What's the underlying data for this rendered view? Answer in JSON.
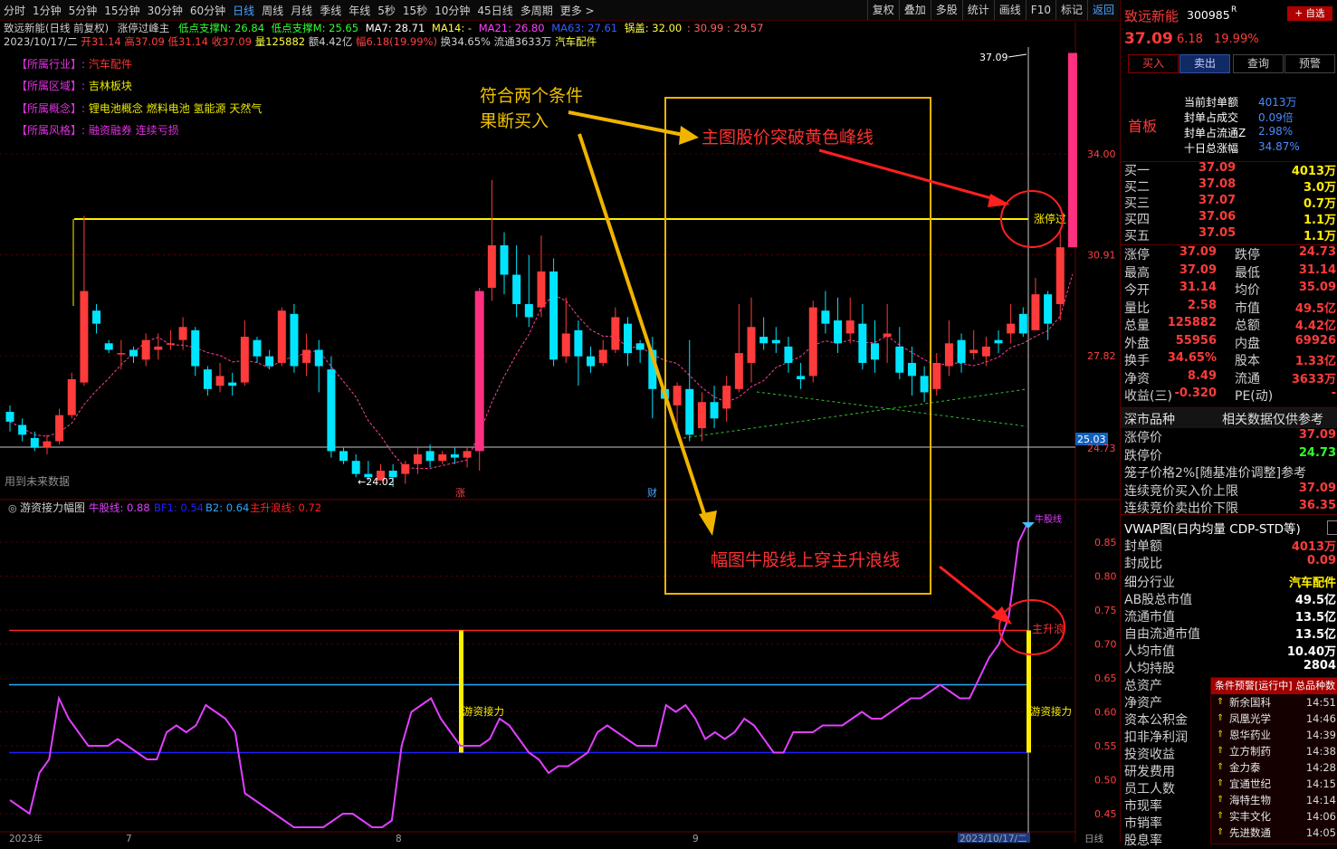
{
  "toolbar": {
    "periods": [
      "分时",
      "1分钟",
      "5分钟",
      "15分钟",
      "30分钟",
      "60分钟",
      "日线",
      "周线",
      "月线",
      "季线",
      "年线",
      "5秒",
      "15秒",
      "10分钟",
      "45日线",
      "多周期",
      "更多 >"
    ],
    "active_period": "日线",
    "tools": [
      "复权",
      "叠加",
      "多股",
      "统计",
      "画线",
      "F10",
      "标记",
      "返回"
    ]
  },
  "stock": {
    "title_line": "致远新能(日线 前复权)",
    "indicator_name": "涨停过峰主",
    "support_n": "低点支撑N: 26.84",
    "support_m": "低点支撑M: 25.65",
    "ma7": "MA7: 28.71",
    "ma14": "MA14: -",
    "ma21": "MA21: 26.80",
    "ma63": "MA63: 27.61",
    "pot_lid": "锅盖: 32.00",
    "levels": ": 30.99 : 29.57",
    "date": "2023/10/17/二",
    "open": "开31.14",
    "high": "高37.09",
    "low": "低31.14",
    "close": "收37.09",
    "volume": "量125882",
    "amount": "额4.42亿",
    "change": "幅6.18(19.99%)",
    "turnover": "换34.65%",
    "float": "流通3633万",
    "sector": "汽车配件"
  },
  "tags": [
    {
      "k": "【所属行业】:",
      "v": "汽车配件",
      "color": "#ff3030"
    },
    {
      "k": "【所属区域】:",
      "v": "吉林板块",
      "color": "#e8e800"
    },
    {
      "k": "【所属概念】:",
      "v": "锂电池概念 燃料电池 氢能源 天然气",
      "color": "#e8e800"
    },
    {
      "k": "【所属风格】:",
      "v": "融资融券 连续亏损",
      "color": "#e030e0"
    }
  ],
  "main_chart": {
    "y_ticks": [
      "34.00",
      "30.91",
      "27.82",
      "25.03",
      "24.73"
    ],
    "peak_label": "37.09",
    "low_label": "←24.02",
    "zt_label": "涨停过",
    "current_price_box": "25.03",
    "marker_zhang": "涨",
    "marker_cai": "财",
    "future_note": "用到未来数据"
  },
  "candles": [
    [
      26.1,
      25.8,
      26.3,
      25.5
    ],
    [
      25.7,
      25.4,
      25.9,
      25.2
    ],
    [
      25.3,
      25.0,
      25.5,
      24.9
    ],
    [
      25.0,
      25.2,
      25.4,
      24.8
    ],
    [
      25.2,
      26.0,
      26.2,
      25.1
    ],
    [
      26.0,
      27.1,
      27.3,
      25.9
    ],
    [
      27.0,
      29.8,
      32.1,
      26.9
    ],
    [
      29.2,
      28.8,
      29.4,
      28.5
    ],
    [
      28.2,
      28.0,
      28.3,
      27.9
    ],
    [
      27.9,
      27.9,
      28.3,
      27.4
    ],
    [
      28.0,
      27.8,
      28.1,
      27.6
    ],
    [
      27.7,
      28.3,
      28.5,
      27.5
    ],
    [
      28.0,
      28.1,
      28.5,
      27.7
    ],
    [
      28.2,
      28.2,
      28.6,
      28.0
    ],
    [
      28.3,
      28.7,
      29.0,
      28.0
    ],
    [
      28.6,
      27.5,
      28.7,
      27.2
    ],
    [
      27.4,
      26.8,
      27.5,
      26.6
    ],
    [
      26.9,
      27.2,
      27.6,
      26.7
    ],
    [
      27.0,
      26.9,
      27.3,
      26.6
    ],
    [
      27.0,
      28.4,
      28.9,
      26.9
    ],
    [
      28.3,
      27.8,
      28.4,
      27.6
    ],
    [
      27.8,
      27.5,
      28.0,
      27.4
    ],
    [
      27.6,
      29.2,
      29.3,
      27.5
    ],
    [
      29.1,
      27.5,
      29.4,
      27.3
    ],
    [
      27.6,
      28.0,
      28.5,
      27.2
    ],
    [
      28.0,
      27.5,
      28.3,
      26.7
    ],
    [
      27.4,
      24.9,
      27.8,
      24.7
    ],
    [
      24.9,
      24.6,
      25.0,
      24.5
    ],
    [
      24.6,
      24.2,
      24.8,
      24.1
    ],
    [
      24.2,
      24.1,
      24.6,
      24.0
    ],
    [
      24.0,
      24.3,
      24.5,
      24.0
    ],
    [
      24.3,
      24.1,
      24.5,
      23.8
    ],
    [
      24.2,
      24.5,
      24.6,
      23.9
    ],
    [
      24.5,
      24.8,
      25.0,
      24.2
    ],
    [
      24.9,
      24.6,
      25.1,
      24.4
    ],
    [
      24.6,
      24.8,
      24.9,
      24.5
    ],
    [
      24.8,
      24.7,
      25.0,
      24.5
    ],
    [
      24.7,
      24.9,
      25.0,
      24.4
    ],
    [
      24.9,
      29.8,
      29.9,
      24.3
    ],
    [
      29.9,
      31.2,
      33.2,
      29.5
    ],
    [
      31.2,
      30.3,
      31.6,
      29.7
    ],
    [
      30.3,
      29.4,
      31.2,
      29.0
    ],
    [
      29.4,
      29.0,
      30.9,
      28.7
    ],
    [
      29.3,
      30.4,
      31.5,
      29.0
    ],
    [
      30.4,
      27.7,
      30.8,
      27.5
    ],
    [
      27.8,
      28.5,
      29.6,
      27.6
    ],
    [
      28.6,
      27.8,
      28.9,
      26.9
    ],
    [
      27.8,
      27.5,
      28.1,
      27.3
    ],
    [
      27.6,
      28.0,
      28.3,
      27.5
    ],
    [
      28.0,
      29.0,
      29.3,
      27.9
    ],
    [
      28.8,
      27.9,
      29.0,
      27.5
    ],
    [
      28.2,
      28.0,
      28.3,
      27.6
    ],
    [
      28.0,
      26.8,
      28.4,
      25.9
    ],
    [
      26.8,
      26.5,
      27.1,
      26.2
    ],
    [
      26.3,
      26.9,
      27.0,
      25.6
    ],
    [
      26.8,
      25.4,
      28.3,
      25.2
    ],
    [
      25.6,
      26.4,
      26.7,
      25.2
    ],
    [
      26.4,
      25.9,
      26.9,
      25.6
    ],
    [
      26.2,
      26.9,
      27.2,
      25.8
    ],
    [
      26.8,
      27.9,
      29.4,
      26.7
    ],
    [
      27.6,
      28.7,
      29.6,
      27.0
    ],
    [
      28.4,
      28.2,
      29.0,
      28.0
    ],
    [
      28.3,
      28.2,
      28.7,
      27.9
    ],
    [
      28.1,
      27.6,
      28.4,
      27.3
    ],
    [
      27.2,
      27.1,
      27.6,
      26.8
    ],
    [
      27.2,
      29.3,
      29.5,
      27.0
    ],
    [
      29.2,
      28.8,
      29.8,
      28.5
    ],
    [
      28.9,
      28.2,
      29.6,
      27.9
    ],
    [
      28.5,
      28.9,
      29.6,
      28.2
    ],
    [
      28.8,
      27.6,
      29.4,
      27.4
    ],
    [
      28.2,
      27.7,
      28.9,
      27.3
    ],
    [
      28.4,
      28.5,
      29.4,
      27.6
    ],
    [
      28.1,
      27.3,
      28.7,
      27.1
    ],
    [
      27.6,
      27.2,
      28.1,
      26.6
    ],
    [
      27.2,
      26.7,
      27.5,
      26.4
    ],
    [
      26.8,
      27.6,
      27.9,
      26.6
    ],
    [
      27.5,
      28.2,
      28.9,
      27.2
    ],
    [
      28.3,
      27.6,
      28.5,
      27.3
    ],
    [
      27.9,
      28.0,
      28.6,
      27.7
    ],
    [
      27.8,
      28.1,
      28.4,
      27.5
    ],
    [
      28.3,
      28.2,
      28.6,
      27.9
    ],
    [
      28.5,
      28.8,
      29.4,
      28.2
    ],
    [
      29.1,
      28.5,
      29.3,
      28.4
    ],
    [
      28.6,
      29.7,
      30.2,
      28.6
    ],
    [
      29.7,
      28.8,
      29.8,
      28.3
    ],
    [
      29.4,
      31.14,
      31.6,
      28.9
    ],
    [
      31.14,
      37.09,
      37.09,
      31.14
    ]
  ],
  "osc_panel": {
    "title": "游资接力幅图",
    "niu_label": "牛股线: 0.88",
    "bf1": "BF1: 0.54",
    "b2": "B2: 0.64",
    "zsl": "主升浪线: 0.72",
    "y_ticks": [
      "0.85",
      "0.80",
      "0.75",
      "0.70",
      "0.65",
      "0.60",
      "0.55",
      "0.50",
      "0.45"
    ],
    "label_relay": "游资接力",
    "label_zsl": "主升浪",
    "label_niu": "牛股线",
    "x_labels": [
      "2023年",
      "7",
      "8",
      "9",
      "2023/10/17/二",
      "日线"
    ]
  },
  "osc_values": [
    0.47,
    0.46,
    0.45,
    0.51,
    0.53,
    0.62,
    0.59,
    0.57,
    0.55,
    0.55,
    0.55,
    0.56,
    0.55,
    0.54,
    0.53,
    0.53,
    0.57,
    0.58,
    0.57,
    0.58,
    0.61,
    0.6,
    0.59,
    0.57,
    0.48,
    0.47,
    0.46,
    0.45,
    0.44,
    0.43,
    0.43,
    0.43,
    0.43,
    0.44,
    0.45,
    0.45,
    0.44,
    0.43,
    0.43,
    0.44,
    0.55,
    0.6,
    0.61,
    0.62,
    0.59,
    0.57,
    0.55,
    0.55,
    0.55,
    0.56,
    0.59,
    0.58,
    0.56,
    0.54,
    0.53,
    0.51,
    0.52,
    0.52,
    0.53,
    0.54,
    0.57,
    0.58,
    0.57,
    0.56,
    0.55,
    0.55,
    0.55,
    0.61,
    0.6,
    0.61,
    0.59,
    0.56,
    0.57,
    0.56,
    0.57,
    0.59,
    0.58,
    0.56,
    0.54,
    0.54,
    0.57,
    0.57,
    0.57,
    0.58,
    0.58,
    0.58,
    0.59,
    0.6,
    0.59,
    0.59,
    0.6,
    0.61,
    0.62,
    0.62,
    0.63,
    0.64,
    0.63,
    0.62,
    0.62,
    0.65,
    0.68,
    0.7,
    0.74,
    0.85,
    0.88
  ],
  "annotations": {
    "text1_line1": "符合两个条件",
    "text1_line2": "果断买入",
    "text2": "主图股价突破黄色峰线",
    "text3": "幅图牛股线上穿主升浪线"
  },
  "right_panel": {
    "name": "致远新能",
    "code": "300985",
    "code_suffix": "R",
    "add_fav": "+ 自选",
    "price": "37.09",
    "change": "6.18",
    "pct": "19.99%",
    "buttons": [
      "买入",
      "卖出",
      "查询",
      "预警"
    ],
    "board_label": "首板",
    "seal_rows": [
      {
        "k": "当前封单额",
        "v": "4013万"
      },
      {
        "k": "封单占成交",
        "v": "0.09倍"
      },
      {
        "k": "封单占流通Z",
        "v": "2.98%"
      },
      {
        "k": "十日总涨幅",
        "v": "34.87%"
      }
    ],
    "bids": [
      {
        "k": "买一",
        "p": "37.09",
        "q": "4013万"
      },
      {
        "k": "买二",
        "p": "37.08",
        "q": "3.0万"
      },
      {
        "k": "买三",
        "p": "37.07",
        "q": "0.7万"
      },
      {
        "k": "买四",
        "p": "37.06",
        "q": "1.1万"
      },
      {
        "k": "买五",
        "p": "37.05",
        "q": "1.1万"
      }
    ],
    "stats": [
      {
        "k1": "涨停",
        "v1": "37.09",
        "k2": "跌停",
        "v2": "24.73"
      },
      {
        "k1": "最高",
        "v1": "37.09",
        "k2": "最低",
        "v2": "31.14"
      },
      {
        "k1": "今开",
        "v1": "31.14",
        "k2": "均价",
        "v2": "35.09"
      },
      {
        "k1": "量比",
        "v1": "2.58",
        "k2": "市值",
        "v2": "49.5亿"
      },
      {
        "k1": "总量",
        "v1": "125882",
        "k2": "总额",
        "v2": "4.42亿"
      },
      {
        "k1": "外盘",
        "v1": "55956",
        "k2": "内盘",
        "v2": "69926"
      },
      {
        "k1": "换手",
        "v1": "34.65%",
        "k2": "股本",
        "v2": "1.33亿"
      },
      {
        "k1": "净资",
        "v1": "8.49",
        "k2": "流通",
        "v2": "3633万"
      },
      {
        "k1": "收益(三)",
        "v1": "-0.320",
        "k2": "PE(动)",
        "v2": "-"
      }
    ],
    "sz_label": "深市品种",
    "sz_note": "相关数据仅供参考",
    "limit_rows": [
      {
        "k": "涨停价",
        "v": "37.09"
      },
      {
        "k": "跌停价",
        "v": "24.73"
      },
      {
        "k": "笼子价格2%[随基准价调整]参考",
        "v": ""
      },
      {
        "k": "连续竞价买入价上限",
        "v": "37.09"
      },
      {
        "k": "连续竞价卖出价下限",
        "v": "36.35"
      }
    ],
    "vwap_title": "VWAP图(日内均量 CDP-STD等)",
    "seal_rows2": [
      {
        "k": "封单额",
        "v": "4013万"
      },
      {
        "k": "封成比",
        "v": "0.09"
      }
    ],
    "fin_rows": [
      {
        "k": "细分行业",
        "v": "汽车配件"
      },
      {
        "k": "AB股总市值",
        "v": "49.5亿"
      },
      {
        "k": "流通市值",
        "v": "13.5亿"
      },
      {
        "k": "自由流通市值",
        "v": "13.5亿"
      },
      {
        "k": "人均市值",
        "v": "10.40万"
      },
      {
        "k": "人均持股",
        "v": "2804"
      },
      {
        "k": "总资产",
        "v": ""
      },
      {
        "k": "净资产",
        "v": ""
      },
      {
        "k": "资本公积金",
        "v": ""
      },
      {
        "k": "扣非净利润",
        "v": ""
      },
      {
        "k": "投资收益",
        "v": ""
      },
      {
        "k": "研发费用",
        "v": ""
      },
      {
        "k": "员工人数",
        "v": ""
      },
      {
        "k": "市现率",
        "v": ""
      },
      {
        "k": "市销率",
        "v": ""
      },
      {
        "k": "股息率",
        "v": ""
      }
    ],
    "alerts_title": "条件预警[运行中] 总品种数",
    "alerts": [
      {
        "n": "新余国科",
        "t": "14:51"
      },
      {
        "n": "凤凰光学",
        "t": "14:46"
      },
      {
        "n": "恩华药业",
        "t": "14:39"
      },
      {
        "n": "立方制药",
        "t": "14:38"
      },
      {
        "n": "金力泰",
        "t": "14:28"
      },
      {
        "n": "宜通世纪",
        "t": "14:15"
      },
      {
        "n": "海特生物",
        "t": "14:14"
      },
      {
        "n": "实丰文化",
        "t": "14:06"
      },
      {
        "n": "先进数通",
        "t": "14:05"
      }
    ]
  },
  "colors": {
    "up": "#ff3b3b",
    "down": "#00e5ff",
    "peak_line": "#ffee00",
    "annotation_box": "#f0b400",
    "osc_line": "#e040ff",
    "zsl_line": "#ff2020",
    "b2_line": "#2aa8ff",
    "bf1_line": "#2020ff"
  }
}
